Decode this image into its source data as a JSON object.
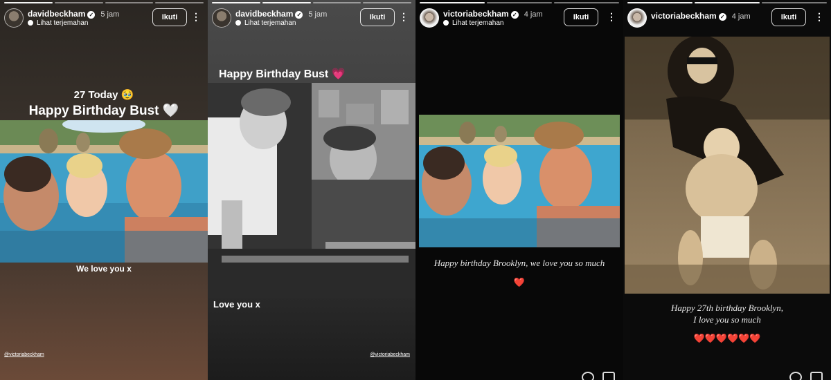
{
  "stories": [
    {
      "username": "davidbeckham",
      "time": "5 jam",
      "translate": "Lihat terjemahan",
      "follow": "Ikuti",
      "title_small": "27 Today 🥹",
      "title_big": "Happy Birthday Bust 🤍",
      "caption": "We love you x",
      "mention": "@victoriabeckham"
    },
    {
      "username": "davidbeckham",
      "time": "5 jam",
      "translate": "Lihat terjemahan",
      "follow": "Ikuti",
      "title": "Happy Birthday Bust 💗",
      "caption": "Love you x",
      "mention": "@victoriabeckham"
    },
    {
      "username": "victoriabeckham",
      "time": "4 jam",
      "translate": "Lihat terjemahan",
      "follow": "Ikuti",
      "caption": "Happy birthday Brooklyn, we love you so much",
      "emoji": "❤️"
    },
    {
      "username": "victoriabeckham",
      "time": "4 jam",
      "follow": "Ikuti",
      "caption_line1": "Happy 27th birthday Brooklyn,",
      "caption_line2": "I love you so much",
      "emoji": "❤️❤️❤️❤️❤️❤️"
    }
  ],
  "icons": {
    "verified": "verified-badge-icon",
    "translate": "translate-icon",
    "more": "more-options-icon"
  },
  "ui_glyphs": {
    "verified_check": "✓",
    "more": "⋮"
  }
}
